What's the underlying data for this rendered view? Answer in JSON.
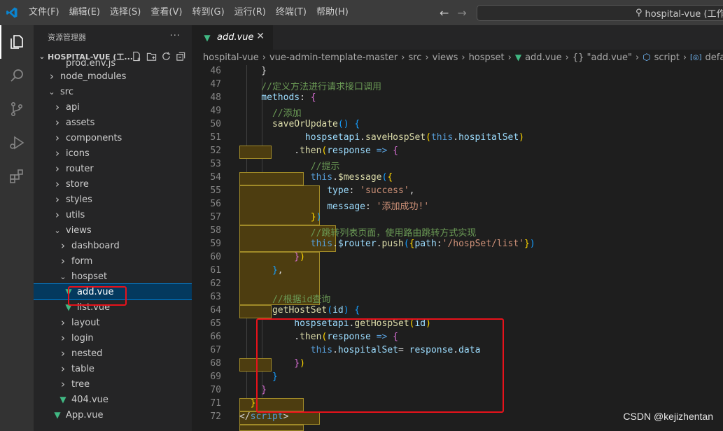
{
  "titlebar": {
    "menus": [
      "文件(F)",
      "编辑(E)",
      "选择(S)",
      "查看(V)",
      "转到(G)",
      "运行(R)",
      "终端(T)",
      "帮助(H)"
    ],
    "search_text": "hospital-vue (工作区"
  },
  "activity_icons": [
    "explorer-icon",
    "search-icon",
    "source-control-icon",
    "run-debug-icon",
    "extensions-icon"
  ],
  "sidebar": {
    "title": "资源管理器",
    "more": "···",
    "project": "HOSPITAL-VUE (工...",
    "items": [
      {
        "label": "prod.env.js",
        "indent": 3,
        "type": "file"
      },
      {
        "label": "node_modules",
        "indent": 2,
        "type": "folder-closed"
      },
      {
        "label": "src",
        "indent": 2,
        "type": "folder-open"
      },
      {
        "label": "api",
        "indent": 3,
        "type": "folder-closed"
      },
      {
        "label": "assets",
        "indent": 3,
        "type": "folder-closed"
      },
      {
        "label": "components",
        "indent": 3,
        "type": "folder-closed"
      },
      {
        "label": "icons",
        "indent": 3,
        "type": "folder-closed"
      },
      {
        "label": "router",
        "indent": 3,
        "type": "folder-closed"
      },
      {
        "label": "store",
        "indent": 3,
        "type": "folder-closed"
      },
      {
        "label": "styles",
        "indent": 3,
        "type": "folder-closed"
      },
      {
        "label": "utils",
        "indent": 3,
        "type": "folder-closed"
      },
      {
        "label": "views",
        "indent": 3,
        "type": "folder-open"
      },
      {
        "label": "dashboard",
        "indent": 4,
        "type": "folder-closed"
      },
      {
        "label": "form",
        "indent": 4,
        "type": "folder-closed"
      },
      {
        "label": "hospset",
        "indent": 4,
        "type": "folder-open"
      },
      {
        "label": "add.vue",
        "indent": 5,
        "type": "vue",
        "selected": true
      },
      {
        "label": "list.vue",
        "indent": 5,
        "type": "vue"
      },
      {
        "label": "layout",
        "indent": 4,
        "type": "folder-closed"
      },
      {
        "label": "login",
        "indent": 4,
        "type": "folder-closed"
      },
      {
        "label": "nested",
        "indent": 4,
        "type": "folder-closed"
      },
      {
        "label": "table",
        "indent": 4,
        "type": "folder-closed"
      },
      {
        "label": "tree",
        "indent": 4,
        "type": "folder-closed"
      },
      {
        "label": "404.vue",
        "indent": 4,
        "type": "vue"
      },
      {
        "label": "App.vue",
        "indent": 3,
        "type": "vue"
      }
    ]
  },
  "editor": {
    "tab_label": "add.vue",
    "breadcrumbs": [
      "hospital-vue",
      "vue-admin-template-master",
      "src",
      "views",
      "hospset",
      "add.vue",
      "{} \"add.vue\"",
      "script",
      "default"
    ],
    "lines": [
      {
        "n": "46",
        "tokens": [
          [
            "pun",
            "    }"
          ]
        ]
      },
      {
        "n": "47",
        "tokens": [
          [
            "com",
            "    //定义方法进行请求接口调用"
          ]
        ]
      },
      {
        "n": "48",
        "tokens": [
          [
            "var",
            "    methods"
          ],
          [
            "pun",
            ": "
          ],
          [
            "br2",
            "{"
          ]
        ]
      },
      {
        "n": "49",
        "tokens": [
          [
            "com",
            "      //添加"
          ]
        ]
      },
      {
        "n": "50",
        "tokens": [
          [
            "fn",
            "      saveOrUpdate"
          ],
          [
            "br3",
            "()"
          ],
          [
            "pun",
            " "
          ],
          [
            "br3",
            "{"
          ]
        ]
      },
      {
        "n": "51",
        "tokens": [
          [
            "var",
            "            hospsetapi"
          ],
          [
            "pun",
            "."
          ],
          [
            "fn",
            "saveHospSet"
          ],
          [
            "br1",
            "("
          ],
          [
            "key",
            "this"
          ],
          [
            "pun",
            "."
          ],
          [
            "var",
            "hospitalSet"
          ],
          [
            "br1",
            ")"
          ]
        ]
      },
      {
        "n": "52",
        "tokens": [
          [
            "pun",
            "          ."
          ],
          [
            "fn",
            "then"
          ],
          [
            "br1",
            "("
          ],
          [
            "var",
            "response"
          ],
          [
            "pun",
            " "
          ],
          [
            "key",
            "=>"
          ],
          [
            "pun",
            " "
          ],
          [
            "br2",
            "{"
          ]
        ]
      },
      {
        "n": "53",
        "tokens": [
          [
            "com",
            "             //提示"
          ]
        ]
      },
      {
        "n": "54",
        "tokens": [
          [
            "key",
            "             this"
          ],
          [
            "pun",
            "."
          ],
          [
            "fn",
            "$message"
          ],
          [
            "br3",
            "("
          ],
          [
            "br1",
            "{"
          ]
        ]
      },
      {
        "n": "55",
        "tokens": [
          [
            "var",
            "                type"
          ],
          [
            "pun",
            ": "
          ],
          [
            "str",
            "'success'"
          ],
          [
            "pun",
            ","
          ]
        ]
      },
      {
        "n": "56",
        "tokens": [
          [
            "var",
            "                message"
          ],
          [
            "pun",
            ": "
          ],
          [
            "str",
            "'添加成功!'"
          ]
        ]
      },
      {
        "n": "57",
        "tokens": [
          [
            "br1",
            "             }"
          ],
          [
            "br3",
            ")"
          ]
        ]
      },
      {
        "n": "58",
        "tokens": [
          [
            "com",
            "             //跳转列表页面，使用路由跳转方式实现"
          ]
        ]
      },
      {
        "n": "59",
        "tokens": [
          [
            "key",
            "             this"
          ],
          [
            "pun",
            "."
          ],
          [
            "var",
            "$router"
          ],
          [
            "pun",
            "."
          ],
          [
            "fn",
            "push"
          ],
          [
            "br3",
            "("
          ],
          [
            "br1",
            "{"
          ],
          [
            "var",
            "path"
          ],
          [
            "pun",
            ":"
          ],
          [
            "str",
            "'/hospSet/list'"
          ],
          [
            "br1",
            "}"
          ],
          [
            "br3",
            ")"
          ]
        ]
      },
      {
        "n": "60",
        "tokens": [
          [
            "br2",
            "          }"
          ],
          [
            "br1",
            ")"
          ]
        ]
      },
      {
        "n": "61",
        "tokens": [
          [
            "br3",
            "      }"
          ],
          [
            "pun",
            ","
          ]
        ]
      },
      {
        "n": "62",
        "tokens": [
          [
            "pun",
            ""
          ]
        ]
      },
      {
        "n": "63",
        "tokens": [
          [
            "com",
            "      //根据id查询"
          ]
        ]
      },
      {
        "n": "64",
        "tokens": [
          [
            "fn",
            "      getHostSet"
          ],
          [
            "br3",
            "("
          ],
          [
            "var",
            "id"
          ],
          [
            "br3",
            ")"
          ],
          [
            "pun",
            " "
          ],
          [
            "br3",
            "{"
          ]
        ]
      },
      {
        "n": "65",
        "tokens": [
          [
            "var",
            "          hospsetapi"
          ],
          [
            "pun",
            "."
          ],
          [
            "fn",
            "getHospSet"
          ],
          [
            "br1",
            "("
          ],
          [
            "var",
            "id"
          ],
          [
            "br1",
            ")"
          ]
        ]
      },
      {
        "n": "66",
        "tokens": [
          [
            "pun",
            "          ."
          ],
          [
            "fn",
            "then"
          ],
          [
            "br1",
            "("
          ],
          [
            "var",
            "response"
          ],
          [
            "pun",
            " "
          ],
          [
            "key",
            "=>"
          ],
          [
            "pun",
            " "
          ],
          [
            "br2",
            "{"
          ]
        ]
      },
      {
        "n": "67",
        "tokens": [
          [
            "key",
            "             this"
          ],
          [
            "pun",
            "."
          ],
          [
            "var",
            "hospitalSet"
          ],
          [
            "pun",
            "= "
          ],
          [
            "var",
            "response"
          ],
          [
            "pun",
            "."
          ],
          [
            "var",
            "data"
          ]
        ]
      },
      {
        "n": "68",
        "tokens": [
          [
            "br2",
            "          }"
          ],
          [
            "br1",
            ")"
          ]
        ]
      },
      {
        "n": "69",
        "tokens": [
          [
            "br3",
            "      }"
          ]
        ]
      },
      {
        "n": "70",
        "tokens": [
          [
            "br2",
            "    }"
          ]
        ]
      },
      {
        "n": "71",
        "tokens": [
          [
            "br1",
            "  }"
          ]
        ]
      },
      {
        "n": "72",
        "tokens": [
          [
            "pun",
            "</"
          ],
          [
            "key",
            "script"
          ],
          [
            "pun",
            ">"
          ]
        ]
      }
    ]
  },
  "watermark": "CSDN @kejizhentan"
}
